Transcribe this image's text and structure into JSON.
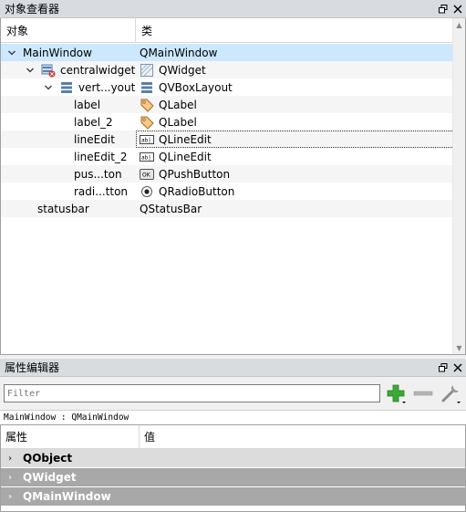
{
  "object_inspector": {
    "title": "对象查看器",
    "float_icon": "float-icon",
    "close_icon": "close-icon",
    "header": {
      "col1": "对象",
      "col2": "类"
    },
    "rows": [
      {
        "name": "MainWindow",
        "cls": "QMainWindow",
        "indent": 0,
        "arrow": "⌄",
        "icon": "",
        "class_icon": ""
      },
      {
        "name": "centralwidget",
        "cls": "QWidget",
        "indent": 1,
        "arrow": "⌄",
        "icon": "widget-icon",
        "class_icon": "qwidget-icon"
      },
      {
        "name": "vert...yout",
        "cls": "QVBoxLayout",
        "indent": 2,
        "arrow": "⌄",
        "icon": "vboxlayout-icon",
        "class_icon": "qvboxlayout-icon"
      },
      {
        "name": "label",
        "cls": "QLabel",
        "indent": 3,
        "arrow": "",
        "icon": "",
        "class_icon": "label-tag-icon"
      },
      {
        "name": "label_2",
        "cls": "QLabel",
        "indent": 3,
        "arrow": "",
        "icon": "",
        "class_icon": "label-tag-icon"
      },
      {
        "name": "lineEdit",
        "cls": "QLineEdit",
        "indent": 3,
        "arrow": "",
        "icon": "",
        "class_icon": "lineedit-icon"
      },
      {
        "name": "lineEdit_2",
        "cls": "QLineEdit",
        "indent": 3,
        "arrow": "",
        "icon": "",
        "class_icon": "lineedit-icon"
      },
      {
        "name": "pus...ton",
        "cls": "QPushButton",
        "indent": 3,
        "arrow": "",
        "icon": "",
        "class_icon": "pushbutton-icon"
      },
      {
        "name": "radi...tton",
        "cls": "QRadioButton",
        "indent": 3,
        "arrow": "",
        "icon": "",
        "class_icon": "radiobutton-icon"
      },
      {
        "name": "statusbar",
        "cls": "QStatusBar",
        "indent": 1,
        "arrow": "",
        "icon": "",
        "class_icon": ""
      }
    ]
  },
  "property_editor": {
    "title": "属性编辑器",
    "filter_placeholder": "Filter",
    "add_icon": "plus-icon",
    "remove_icon": "minus-icon",
    "configure_icon": "wrench-icon",
    "object_caption": "MainWindow : QMainWindow",
    "header": {
      "col1": "属性",
      "col2": "值"
    },
    "groups": [
      "QObject",
      "QWidget",
      "QMainWindow"
    ]
  },
  "colors": {
    "selection": "#cce8ff",
    "group_dark": "#a8a8a8",
    "plus_green": "#3aa935"
  }
}
